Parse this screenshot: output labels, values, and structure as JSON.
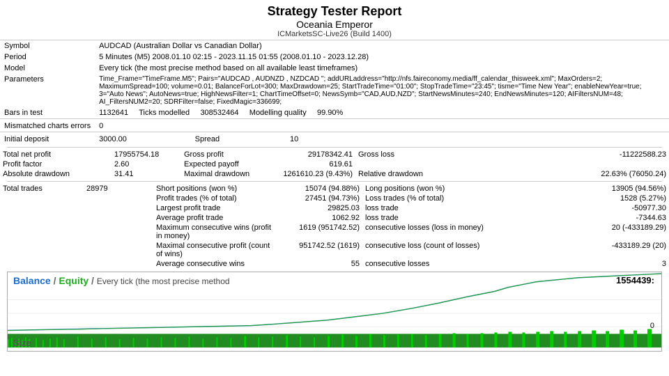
{
  "header": {
    "title": "Strategy Tester Report",
    "subtitle": "Oceania Emperor",
    "build": "ICMarketsSC-Live26 (Build 1400)"
  },
  "info": {
    "symbol_label": "Symbol",
    "symbol_value": "AUDCAD (Australian Dollar vs Canadian Dollar)",
    "period_label": "Period",
    "period_value": "5 Minutes (M5) 2008.01.10 02:15 - 2023.11.15 01:55 (2008.01.10 - 2023.12.28)",
    "model_label": "Model",
    "model_value": "Every tick (the most precise method based on all available least timeframes)",
    "parameters_label": "Parameters",
    "parameters_value": "Time_Frame=\"TimeFrame.M5\"; Pairs=\"AUDCAD , AUDNZD , NZDCAD \"; addURLaddress=\"http://nfs.faireconomy.media/ff_calendar_thisweek.xml\"; MaxOrders=2; MaximumSpread=100; volume=0.01; BalanceForLot=300; MaxDrawdown=25; StartTradeTime=\"01:00\"; StopTradeTime=\"23:45\"; tisme=\"Time New Year\"; enableNewYear=true; 3=\"Auto News\"; AutoNews=true; HighNewsFilter=1; ChartTimeOffset=0; NewsSymb=\"CAD,AUD,NZD\"; StartNewsMinutes=240; EndNewsMinutes=120; AIFiltersNUM=48; AI_FiltersNUM2=20; SDRFilter=false; FixedMagic=336699;",
    "bars_label": "Bars in test",
    "bars_value": "1132641",
    "ticks_label": "Ticks modelled",
    "ticks_value": "308532464",
    "modelling_label": "Modelling quality",
    "modelling_value": "99.90%",
    "mismatched_label": "Mismatched charts errors",
    "mismatched_value": "0",
    "initial_deposit_label": "Initial deposit",
    "initial_deposit_value": "3000.00",
    "spread_label": "Spread",
    "spread_value": "10"
  },
  "stats": {
    "total_net_label": "Total net profit",
    "total_net_value": "17955754.18",
    "gross_profit_label": "Gross profit",
    "gross_profit_value": "29178342.41",
    "gross_loss_label": "Gross loss",
    "gross_loss_value": "-11222588.23",
    "profit_factor_label": "Profit factor",
    "profit_factor_value": "2.60",
    "expected_payoff_label": "Expected payoff",
    "expected_payoff_value": "619.61",
    "absolute_drawdown_label": "Absolute drawdown",
    "absolute_drawdown_value": "31.41",
    "maximal_drawdown_label": "Maximal drawdown",
    "maximal_drawdown_value": "1261610.23 (9.43%)",
    "relative_drawdown_label": "Relative drawdown",
    "relative_drawdown_value": "22.63% (76050.24)",
    "total_trades_label": "Total trades",
    "total_trades_value": "28979",
    "short_positions_label": "Short positions (won %)",
    "short_positions_value": "15074 (94.88%)",
    "long_positions_label": "Long positions (won %)",
    "long_positions_value": "13905 (94.56%)",
    "profit_trades_label": "Profit trades (% of total)",
    "profit_trades_value": "27451 (94.73%)",
    "loss_trades_label": "Loss trades (% of total)",
    "loss_trades_value": "1528 (5.27%)",
    "largest_profit_label": "Largest  profit trade",
    "largest_profit_value": "29825.03",
    "largest_loss_label": "loss trade",
    "largest_loss_value": "-50977.30",
    "average_profit_label": "Average  profit trade",
    "average_profit_value": "1062.92",
    "average_loss_label": "loss trade",
    "average_loss_value": "-7344.63",
    "max_consec_wins_label": "Maximum  consecutive wins (profit in money)",
    "max_consec_wins_value": "1619 (951742.52)",
    "max_consec_losses_label": "consecutive losses (loss in money)",
    "max_consec_losses_value": "20 (-433189.29)",
    "maximal_consec_profit_label": "Maximal  consecutive profit (count of wins)",
    "maximal_consec_profit_value": "951742.52 (1619)",
    "maximal_consec_loss_label": "consecutive loss (count of losses)",
    "maximal_consec_loss_value": "-433189.29 (20)",
    "average_consec_wins_label": "Average  consecutive wins",
    "average_consec_wins_value": "55",
    "average_consec_losses_label": "consecutive losses",
    "average_consec_losses_value": "3"
  },
  "chart": {
    "balance_label": "Balance",
    "equity_label": "Equity",
    "separator": "/",
    "description": "Every tick (the most precise method",
    "value": "1554439:",
    "zero_label": "0",
    "size_label": "Size"
  }
}
